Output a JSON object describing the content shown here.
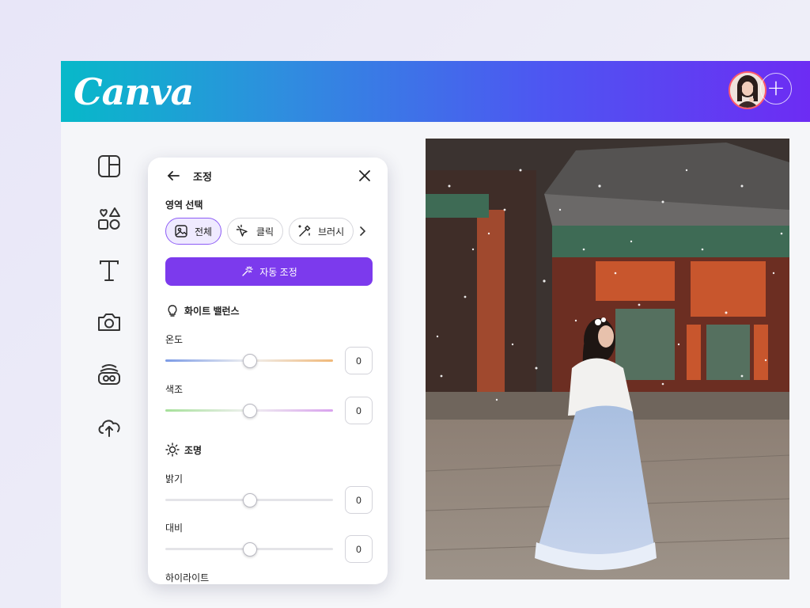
{
  "header": {
    "logo_text": "Canva",
    "add_label": "+",
    "gradient": [
      "#07b9c9",
      "#2f8ddf",
      "#4e55f2",
      "#6d2cf3"
    ]
  },
  "sidebar": {
    "items": [
      {
        "icon": "layout-icon"
      },
      {
        "icon": "elements-icon"
      },
      {
        "icon": "text-icon"
      },
      {
        "icon": "camera-icon"
      },
      {
        "icon": "brand-icon"
      },
      {
        "icon": "upload-icon"
      }
    ]
  },
  "panel": {
    "title": "조정",
    "area_label": "영역 선택",
    "chips": [
      {
        "label": "전체",
        "selected": true
      },
      {
        "label": "클릭",
        "selected": false
      },
      {
        "label": "브러시",
        "selected": false
      }
    ],
    "auto_label": "자동 조정",
    "white_balance": {
      "title": "화이트 밸런스",
      "sliders": [
        {
          "label": "온도",
          "value": "0"
        },
        {
          "label": "색조",
          "value": "0"
        }
      ]
    },
    "lighting": {
      "title": "조명",
      "sliders": [
        {
          "label": "밝기",
          "value": "0"
        },
        {
          "label": "대비",
          "value": "0"
        }
      ],
      "next_label": "하이라이트"
    }
  },
  "accent_color": "#7c3aed"
}
